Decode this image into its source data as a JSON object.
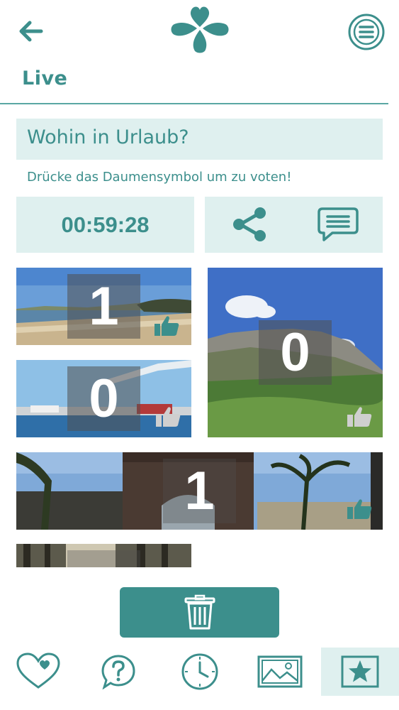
{
  "header": {
    "back_icon": "back-arrow-icon",
    "logo_icon": "clover-logo-icon",
    "menu_icon": "menu-icon",
    "section_title": "Live"
  },
  "poll": {
    "question": "Wohin in Urlaub?",
    "hint": "Drücke das Daumensymbol um zu voten!",
    "timer": "00:59:28",
    "share_icon": "share-icon",
    "comment_icon": "comment-icon"
  },
  "photos": [
    {
      "name": "beach",
      "votes": "1",
      "voted": true
    },
    {
      "name": "mountain",
      "votes": "0",
      "voted": false
    },
    {
      "name": "harbor",
      "votes": "0",
      "voted": false
    },
    {
      "name": "arch",
      "votes": "1",
      "voted": true
    },
    {
      "name": "forest",
      "votes": "",
      "voted": false
    }
  ],
  "delete_icon": "trash-icon",
  "tabbar": [
    {
      "icon": "heart-icon",
      "active": false
    },
    {
      "icon": "question-icon",
      "active": false
    },
    {
      "icon": "clock-icon",
      "active": false
    },
    {
      "icon": "image-icon",
      "active": false
    },
    {
      "icon": "star-icon",
      "active": true
    }
  ],
  "colors": {
    "accent": "#3c8f8c",
    "panel": "#dff0ef"
  }
}
